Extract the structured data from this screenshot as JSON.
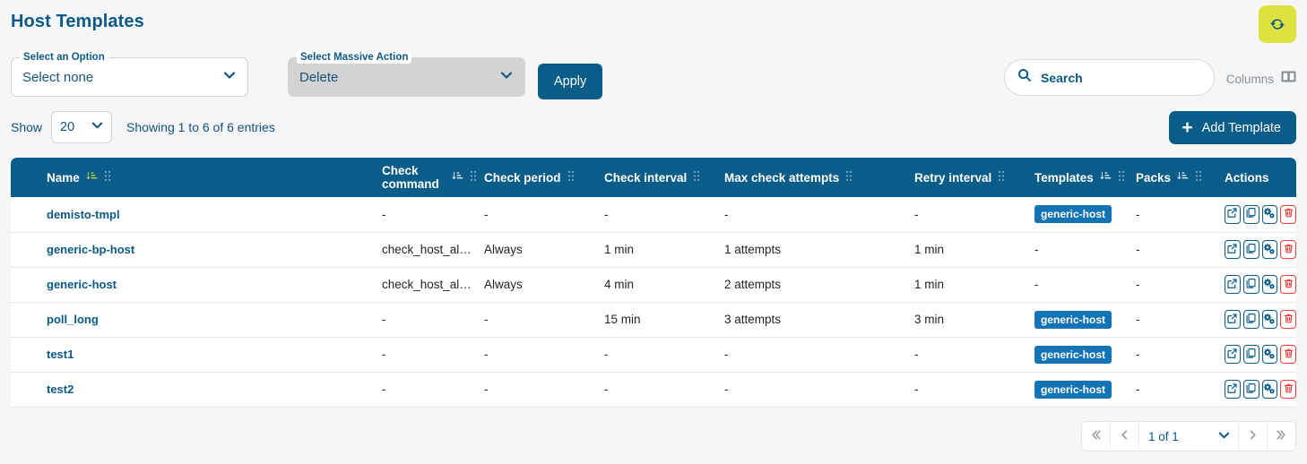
{
  "header": {
    "title": "Host Templates",
    "refresh_icon": "refresh-icon"
  },
  "filters": {
    "option_select": {
      "label": "Select an Option",
      "value": "Select none"
    },
    "massive_action_select": {
      "label": "Select Massive Action",
      "value": "Delete"
    },
    "apply_label": "Apply"
  },
  "search": {
    "placeholder": "Search",
    "icon": "search-icon"
  },
  "columns_control": {
    "label": "Columns",
    "icon": "columns-icon"
  },
  "toolbar": {
    "show_label": "Show",
    "show_value": "20",
    "entries_text": "Showing 1 to 6 of 6 entries",
    "add_label": "Add Template",
    "add_icon": "plus-icon"
  },
  "table": {
    "columns": [
      {
        "label": "Name",
        "sortable": true,
        "sort_active": true,
        "gripable": true
      },
      {
        "label": "Check command",
        "sortable": true,
        "sort_active": false,
        "gripable": true
      },
      {
        "label": "Check period",
        "sortable": false,
        "sort_active": false,
        "gripable": true
      },
      {
        "label": "Check interval",
        "sortable": false,
        "sort_active": false,
        "gripable": true
      },
      {
        "label": "Max check attempts",
        "sortable": false,
        "sort_active": false,
        "gripable": true
      },
      {
        "label": "Retry interval",
        "sortable": false,
        "sort_active": false,
        "gripable": true
      },
      {
        "label": "Templates",
        "sortable": true,
        "sort_active": false,
        "gripable": true
      },
      {
        "label": "Packs",
        "sortable": true,
        "sort_active": false,
        "gripable": true
      },
      {
        "label": "Actions",
        "sortable": false,
        "sort_active": false,
        "gripable": false
      }
    ],
    "rows": [
      {
        "name": "demisto-tmpl",
        "check_command": "-",
        "check_period": "-",
        "check_interval": "-",
        "max_check_attempts": "-",
        "retry_interval": "-",
        "templates": "generic-host",
        "packs": "-"
      },
      {
        "name": "generic-bp-host",
        "check_command": "check_host_al…",
        "check_period": "Always",
        "check_interval": "1 min",
        "max_check_attempts": "1 attempts",
        "retry_interval": "1 min",
        "templates": "-",
        "packs": "-"
      },
      {
        "name": "generic-host",
        "check_command": "check_host_al…",
        "check_period": "Always",
        "check_interval": "4 min",
        "max_check_attempts": "2 attempts",
        "retry_interval": "1 min",
        "templates": "-",
        "packs": "-"
      },
      {
        "name": "poll_long",
        "check_command": "-",
        "check_period": "-",
        "check_interval": "15 min",
        "max_check_attempts": "3 attempts",
        "retry_interval": "3 min",
        "templates": "generic-host",
        "packs": "-"
      },
      {
        "name": "test1",
        "check_command": "-",
        "check_period": "-",
        "check_interval": "-",
        "max_check_attempts": "-",
        "retry_interval": "-",
        "templates": "generic-host",
        "packs": "-"
      },
      {
        "name": "test2",
        "check_command": "-",
        "check_period": "-",
        "check_interval": "-",
        "max_check_attempts": "-",
        "retry_interval": "-",
        "templates": "generic-host",
        "packs": "-"
      }
    ],
    "row_actions": [
      {
        "name": "open-external-icon",
        "title": "Open"
      },
      {
        "name": "duplicate-icon",
        "title": "Duplicate"
      },
      {
        "name": "gears-icon",
        "title": "Configure"
      },
      {
        "name": "trash-icon",
        "title": "Delete"
      }
    ]
  },
  "pagination": {
    "first_icon": "double-chevron-left-icon",
    "prev_icon": "chevron-left-icon",
    "page_label": "1 of 1",
    "next_icon": "chevron-right-icon",
    "last_icon": "double-chevron-right-icon"
  },
  "colors": {
    "brand_blue": "#0a5c89",
    "accent_yellow": "#dee23f",
    "badge_blue": "#1273b5",
    "danger_red": "#ee3b3b",
    "page_bg": "#f4f6f7"
  }
}
